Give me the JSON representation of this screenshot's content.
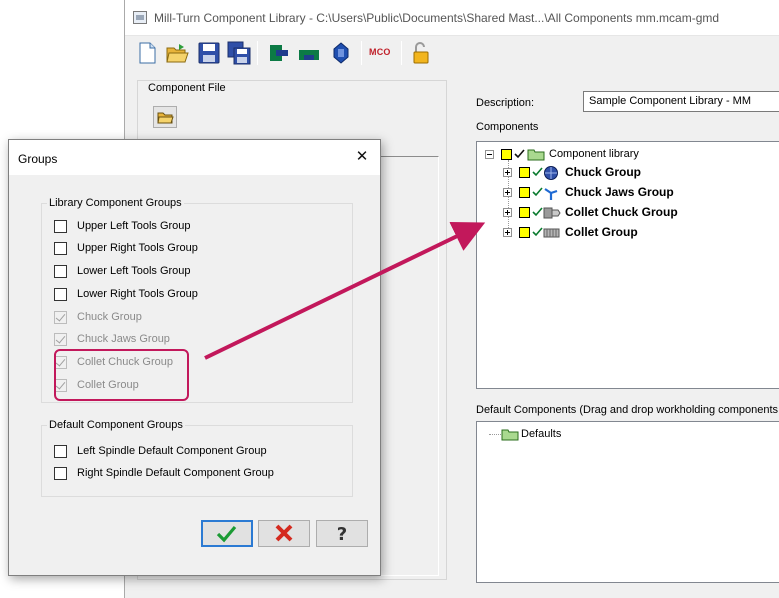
{
  "main_window": {
    "title": "Mill-Turn Component Library - C:\\Users\\Public\\Documents\\Shared Mast...\\All Components mm.mcam-gmd",
    "toolbar": {
      "new_icon": "new-file-icon",
      "open_icon": "open-folder-icon",
      "save_icon": "save-icon",
      "save_all_icon": "save-all-icon",
      "mco_label": "MCO"
    },
    "component_file_label": "Component File",
    "description_label": "Description:",
    "description_value": "Sample Component Library - MM",
    "components_label": "Components",
    "components_tree": {
      "root_label": "Component library",
      "items": [
        {
          "label": "Chuck Group",
          "icon": "chuck-icon"
        },
        {
          "label": "Chuck Jaws Group",
          "icon": "chuck-jaws-icon"
        },
        {
          "label": "Collet Chuck Group",
          "icon": "collet-chuck-icon"
        },
        {
          "label": "Collet Group",
          "icon": "collet-icon"
        }
      ]
    },
    "default_components_label": "Default Components (Drag and drop workholding components fr",
    "defaults_tree": {
      "root_label": "Defaults"
    }
  },
  "groups_dialog": {
    "title": "Groups",
    "library_groups_title": "Library Component Groups",
    "library_groups": [
      {
        "label": "Upper Left Tools Group",
        "checked": false,
        "enabled": true
      },
      {
        "label": "Upper Right Tools Group",
        "checked": false,
        "enabled": true
      },
      {
        "label": "Lower Left Tools Group",
        "checked": false,
        "enabled": true
      },
      {
        "label": "Lower Right Tools Group",
        "checked": false,
        "enabled": true
      },
      {
        "label": "Chuck Group",
        "checked": true,
        "enabled": false
      },
      {
        "label": "Chuck Jaws Group",
        "checked": true,
        "enabled": false
      },
      {
        "label": "Collet Chuck Group",
        "checked": true,
        "enabled": false
      },
      {
        "label": "Collet Group",
        "checked": true,
        "enabled": false
      }
    ],
    "default_groups_title": "Default Component Groups",
    "default_groups": [
      {
        "label": "Left Spindle Default Component Group",
        "checked": false,
        "enabled": true
      },
      {
        "label": "Right Spindle Default Component Group",
        "checked": false,
        "enabled": true
      }
    ],
    "buttons": {
      "ok_icon": "green-check-icon",
      "cancel_icon": "red-x-icon",
      "help_icon": "question-mark-icon"
    },
    "annotation_color": "#c2185b"
  }
}
